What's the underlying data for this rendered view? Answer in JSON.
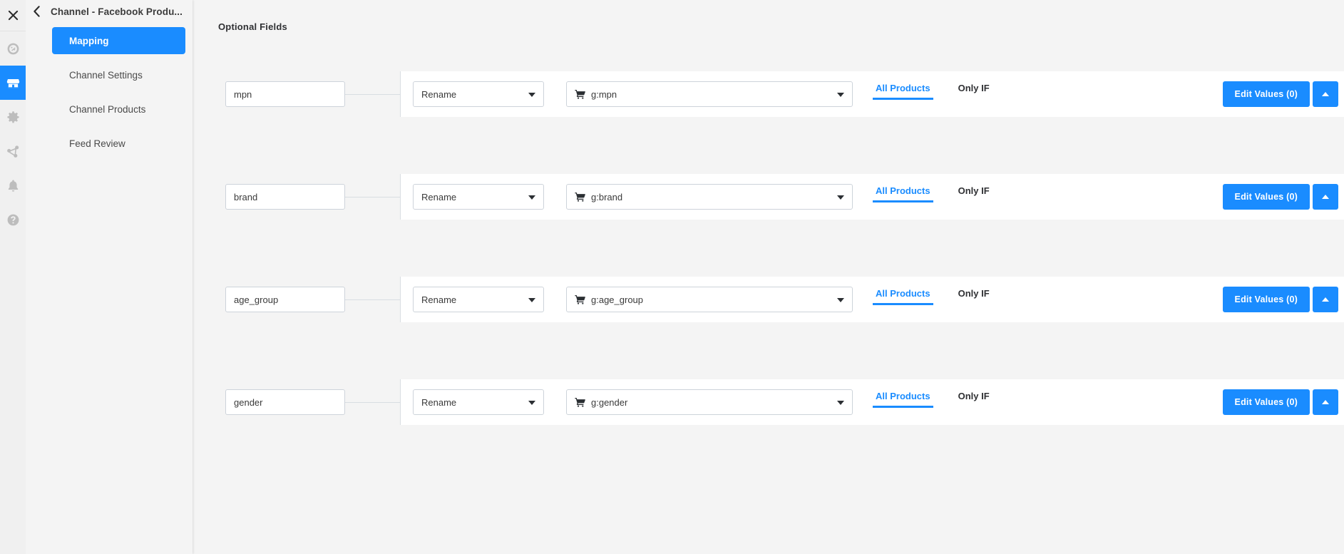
{
  "rail": {
    "close_icon": "close-icon",
    "items": [
      {
        "icon": "dashboard-icon",
        "active": false
      },
      {
        "icon": "store-icon",
        "active": true
      },
      {
        "icon": "gear-icon",
        "active": false
      },
      {
        "icon": "share-network-icon",
        "active": false
      },
      {
        "icon": "bell-icon",
        "active": false
      },
      {
        "icon": "help-circle-icon",
        "active": false
      }
    ]
  },
  "sidebar": {
    "back_icon": "chevron-left-icon",
    "title": "Channel - Facebook Produ...",
    "items": [
      {
        "label": "Mapping",
        "active": true
      },
      {
        "label": "Channel Settings",
        "active": false
      },
      {
        "label": "Channel Products",
        "active": false
      },
      {
        "label": "Feed Review",
        "active": false
      }
    ]
  },
  "main": {
    "section_title": "Optional Fields",
    "tab_all_label": "All Products",
    "tab_onlyif_label": "Only IF",
    "edit_values_label": "Edit Values (0)",
    "collapse_icon": "chevron-up-icon",
    "target_icon": "shopping-cart-icon",
    "rows": [
      {
        "source": "mpn",
        "action": "Rename",
        "target": "g:mpn"
      },
      {
        "source": "brand",
        "action": "Rename",
        "target": "g:brand"
      },
      {
        "source": "age_group",
        "action": "Rename",
        "target": "g:age_group"
      },
      {
        "source": "gender",
        "action": "Rename",
        "target": "g:gender"
      }
    ]
  },
  "colors": {
    "accent": "#1a8cff",
    "page_bg": "#f4f4f4",
    "card_bg": "#ffffff"
  }
}
